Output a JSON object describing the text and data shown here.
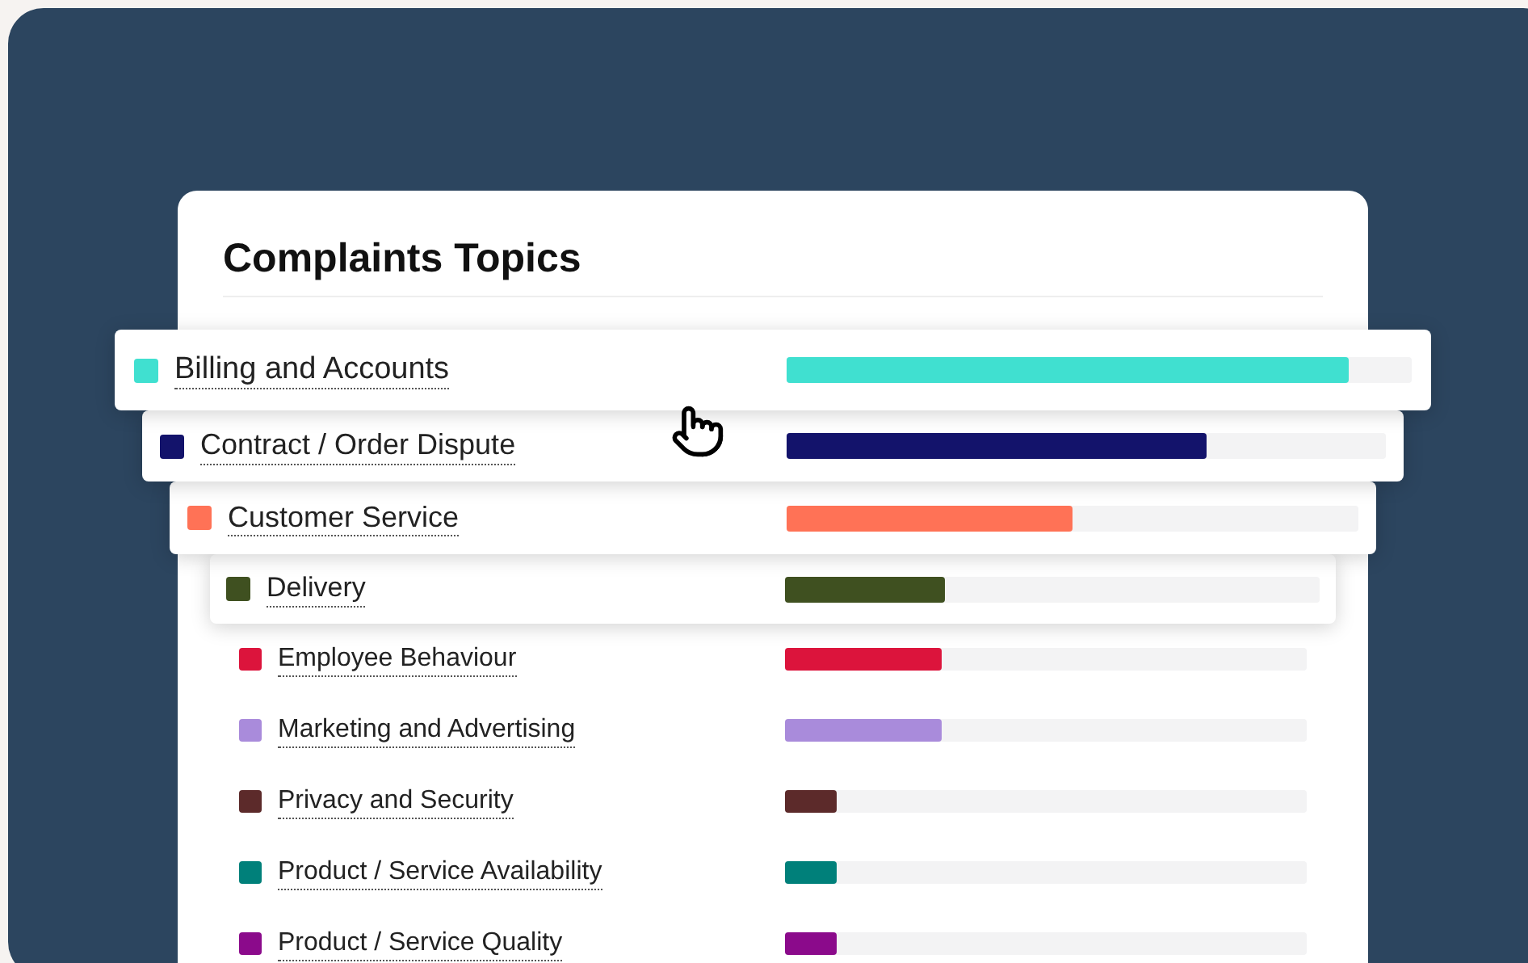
{
  "card": {
    "title": "Complaints Topics"
  },
  "topics": [
    {
      "label": "Billing and Accounts",
      "color": "#40e0d0",
      "level": 0.9,
      "kind": "raised"
    },
    {
      "label": "Contract / Order Dispute",
      "color": "#13136b",
      "level": 0.7,
      "kind": "raised"
    },
    {
      "label": "Customer Service",
      "color": "#ff7256",
      "level": 0.5,
      "kind": "raised"
    },
    {
      "label": "Delivery",
      "color": "#3f5020",
      "level": 0.3,
      "kind": "raised"
    },
    {
      "label": "Employee Behaviour",
      "color": "#dc143c",
      "level": 0.3,
      "kind": "plain"
    },
    {
      "label": "Marketing and Advertising",
      "color": "#a98bdb",
      "level": 0.3,
      "kind": "plain"
    },
    {
      "label": "Privacy and Security",
      "color": "#5c2a2a",
      "level": 0.1,
      "kind": "plain"
    },
    {
      "label": "Product / Service Availability",
      "color": "#00807a",
      "level": 0.1,
      "kind": "plain"
    },
    {
      "label": "Product / Service Quality",
      "color": "#8b0a8b",
      "level": 0.1,
      "kind": "plain"
    }
  ]
}
